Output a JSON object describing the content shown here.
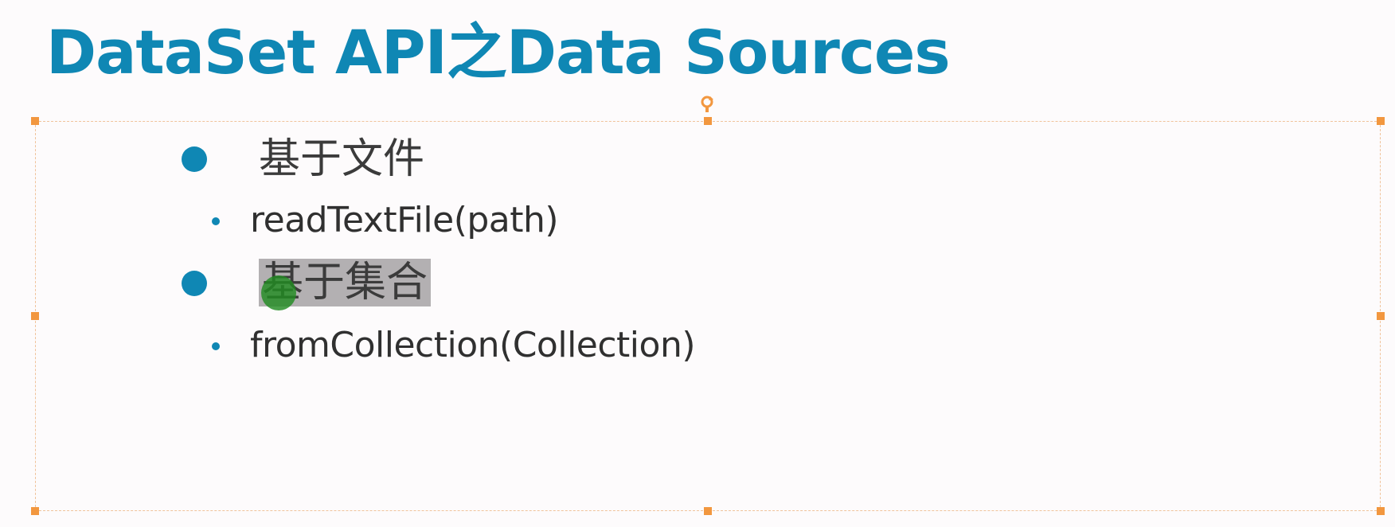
{
  "slide": {
    "title": "DataSet API之Data Sources",
    "items": [
      {
        "label": "基于文件",
        "sub": "readTextFile(path)"
      },
      {
        "label": "基于集合",
        "sub": "fromCollection(Collection)"
      }
    ]
  },
  "colors": {
    "title": "#0f87b4",
    "bullet": "#0f87b4",
    "selection_handle": "#f2973f",
    "highlight": "#b3b0b2",
    "cursor": "#228b22"
  },
  "icons": {
    "rotate": "rotate-handle-icon",
    "cursor": "mouse-cursor-icon"
  }
}
